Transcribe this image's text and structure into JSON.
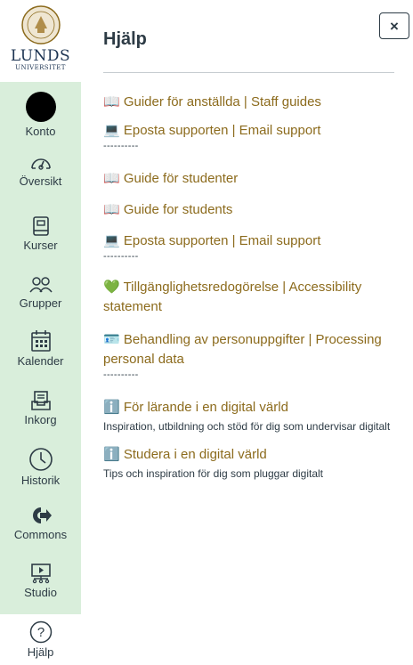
{
  "nav": {
    "logo": {
      "line1": "LUNDS",
      "line2": "UNIVERSITET"
    },
    "items": [
      {
        "label": "Konto",
        "icon": "avatar"
      },
      {
        "label": "Översikt",
        "icon": "dashboard-icon"
      },
      {
        "label": "Kurser",
        "icon": "courses-icon"
      },
      {
        "label": "Grupper",
        "icon": "groups-icon"
      },
      {
        "label": "Kalender",
        "icon": "calendar-icon"
      },
      {
        "label": "Inkorg",
        "icon": "inbox-icon"
      },
      {
        "label": "Historik",
        "icon": "history-icon"
      },
      {
        "label": "Commons",
        "icon": "commons-icon"
      },
      {
        "label": "Studio",
        "icon": "studio-icon"
      },
      {
        "label": "Hjälp",
        "icon": "help-icon"
      }
    ],
    "active": "Hjälp",
    "colors": {
      "nav_bg": "#d9eedb",
      "text": "#2d3b45"
    }
  },
  "tray": {
    "title": "Hjälp",
    "close_label": "×",
    "link_color": "#8c6b1d",
    "links": [
      {
        "text": "📖 Guider för anställda | Staff guides",
        "desc": "",
        "after": ""
      },
      {
        "text": "💻 Eposta supporten | Email support",
        "desc": "",
        "after": "----------"
      },
      {
        "text": "📖 Guide för studenter",
        "desc": "",
        "after": ""
      },
      {
        "text": "📖 Guide for students",
        "desc": "",
        "after": ""
      },
      {
        "text": "💻 Eposta supporten | Email support",
        "desc": "",
        "after": "----------"
      },
      {
        "text": "💚 Tillgänglighetsredogörelse | Accessibility statement",
        "desc": "",
        "after": ""
      },
      {
        "text": "🪪 Behandling av personuppgifter | Processing personal data",
        "desc": "",
        "after": "----------"
      },
      {
        "text": "ℹ️ För lärande i en digital värld",
        "desc": "Inspiration, utbildning och stöd för dig som undervisar digitalt",
        "after": ""
      },
      {
        "text": "ℹ️ Studera i en digital värld",
        "desc": "Tips och inspiration för dig som pluggar digitalt",
        "after": ""
      }
    ]
  }
}
